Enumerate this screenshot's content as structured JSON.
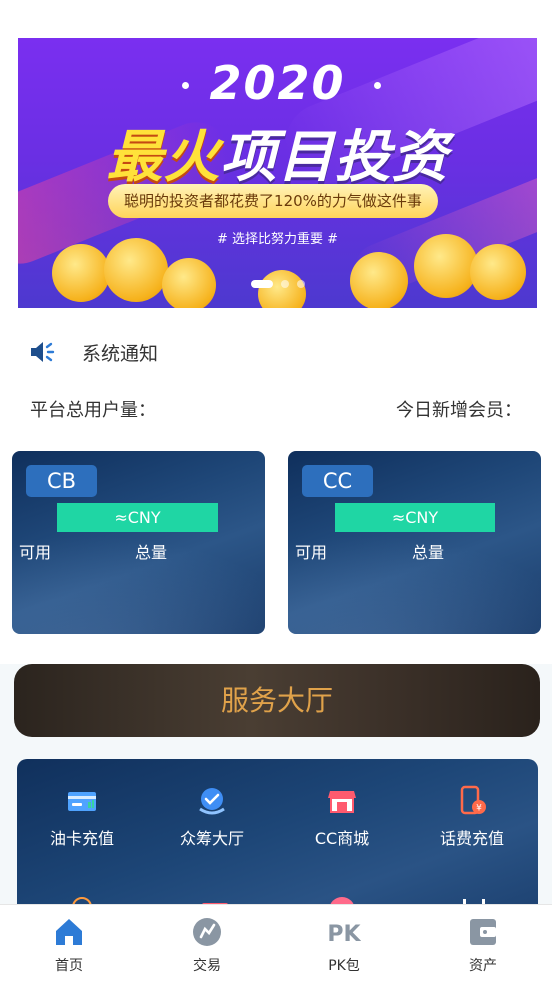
{
  "banner": {
    "year": "2020",
    "headline_hot": "最火",
    "headline_rest": "项目投资",
    "tagline": "聪明的投资者都花费了120%的力气做这件事",
    "subtitle": "# 选择比努力重要 #",
    "active_slide": 1,
    "slide_count": 3
  },
  "notice": {
    "text": "系统通知"
  },
  "stats": {
    "total_users_label": "平台总用户量：",
    "new_members_label": "今日新增会员："
  },
  "cards": [
    {
      "code": "CB",
      "cny": "≈CNY",
      "available_label": "可用",
      "total_label": "总量"
    },
    {
      "code": "CC",
      "cny": "≈CNY",
      "available_label": "可用",
      "total_label": "总量"
    }
  ],
  "service_hall": {
    "title": "服务大厅"
  },
  "services": [
    {
      "label": "油卡充值",
      "icon": "fuel-card-icon"
    },
    {
      "label": "众筹大厅",
      "icon": "crowdfunding-icon"
    },
    {
      "label": "CC商城",
      "icon": "shop-icon"
    },
    {
      "label": "话费充值",
      "icon": "phone-recharge-icon"
    }
  ],
  "tabs": [
    {
      "label": "首页",
      "icon": "home-icon",
      "active": true
    },
    {
      "label": "交易",
      "icon": "trade-icon"
    },
    {
      "label": "PK包",
      "icon": "pk-icon"
    },
    {
      "label": "资产",
      "icon": "wallet-icon"
    }
  ],
  "colors": {
    "accent_blue": "#2d7bd6",
    "cny_green": "#1fd6a4",
    "hall_gold": "#e0a24a",
    "tab_inactive": "#8a96a3"
  }
}
